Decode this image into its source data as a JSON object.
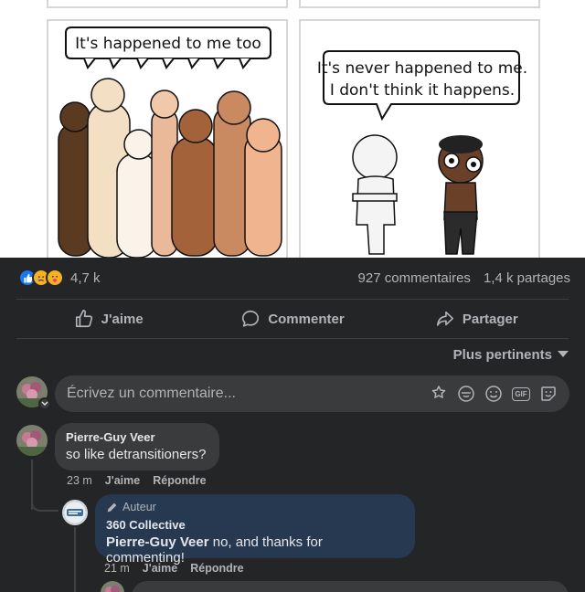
{
  "comic": {
    "left_bubble": "It's happened to me too",
    "right_bubble_line1": "It's never happened to me.",
    "right_bubble_line2": "I don't think it happens."
  },
  "stats": {
    "reaction_icons": [
      "like-icon",
      "sad-icon",
      "care-icon"
    ],
    "reaction_count": "4,7 k",
    "comments": "927 commentaires",
    "shares": "1,4 k partages"
  },
  "actions": {
    "like": "J'aime",
    "comment": "Commenter",
    "share": "Partager"
  },
  "sort": {
    "label": "Plus pertinents"
  },
  "write": {
    "placeholder": "Écrivez un commentaire..."
  },
  "comment": {
    "author": "Pierre-Guy Veer",
    "text": "so like detransitioners?",
    "time": "23 m",
    "like": "J'aime",
    "reply": "Répondre"
  },
  "reply": {
    "badge": "Auteur",
    "author": "360 Collective",
    "mention": "Pierre-Guy Veer",
    "text": " no, and thanks for commenting!",
    "time": "21 m",
    "like": "J'aime",
    "reply": "Répondre"
  },
  "colors": {
    "background": "#242526",
    "bubble": "#3a3b3c",
    "author_bubble": "#263951",
    "muted_text": "#b0b3b8",
    "text": "#e4e6eb",
    "like_blue": "#1877f2"
  }
}
